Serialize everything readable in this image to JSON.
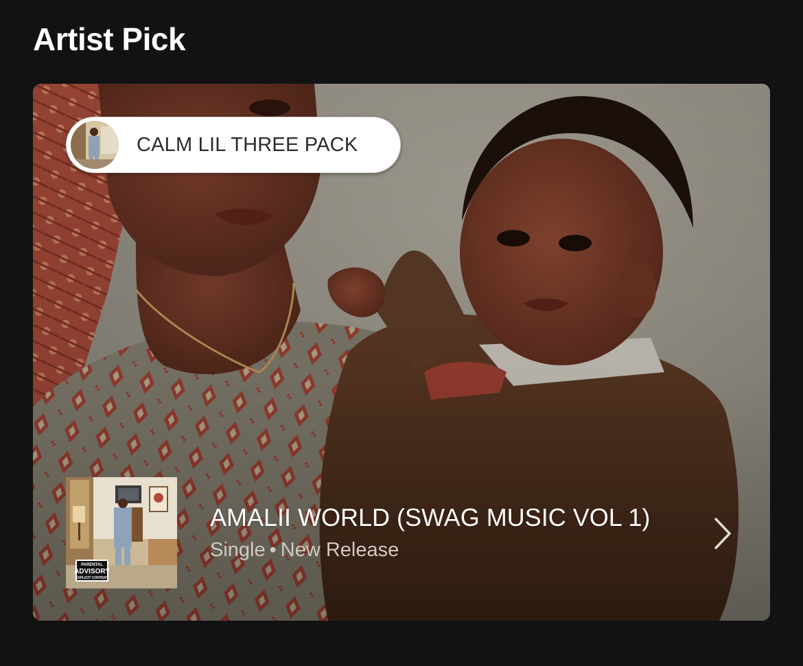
{
  "section": {
    "title": "Artist Pick"
  },
  "pick": {
    "label": "CALM LIL THREE PACK",
    "avatar_icon": "artist-avatar"
  },
  "release": {
    "title": "AMALII WORLD (SWAG MUSIC VOL 1)",
    "type": "Single",
    "separator": "•",
    "status": "New Release",
    "advisory_line1": "PARENTAL",
    "advisory_line2": "ADVISORY",
    "advisory_line3": "EXPLICIT CONTENT",
    "chevron_icon": "chevron-right-icon"
  },
  "colors": {
    "background": "#121212",
    "title_text": "#ffffff",
    "pill_bg": "#ffffff",
    "pill_text": "#2b2b2b",
    "meta_text": "#cfcac3"
  }
}
